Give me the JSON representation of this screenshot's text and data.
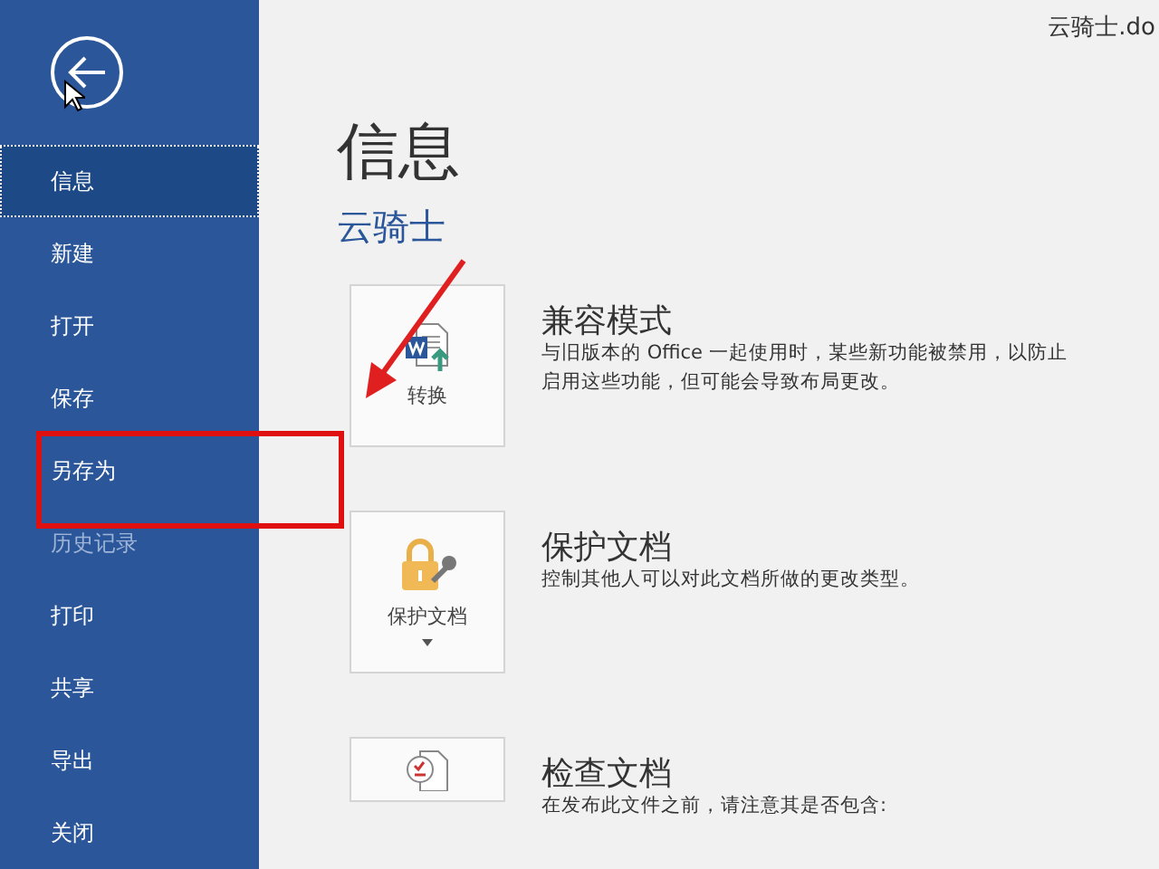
{
  "window": {
    "title": "云骑士.do"
  },
  "sidebar": {
    "items": [
      {
        "label": "信息",
        "selected": true,
        "disabled": false
      },
      {
        "label": "新建",
        "selected": false,
        "disabled": false
      },
      {
        "label": "打开",
        "selected": false,
        "disabled": false
      },
      {
        "label": "保存",
        "selected": false,
        "disabled": false
      },
      {
        "label": "另存为",
        "selected": false,
        "disabled": false
      },
      {
        "label": "历史记录",
        "selected": false,
        "disabled": true
      },
      {
        "label": "打印",
        "selected": false,
        "disabled": false
      },
      {
        "label": "共享",
        "selected": false,
        "disabled": false
      },
      {
        "label": "导出",
        "selected": false,
        "disabled": false
      },
      {
        "label": "关闭",
        "selected": false,
        "disabled": false
      }
    ]
  },
  "page": {
    "title": "信息",
    "document_name": "云骑士"
  },
  "sections": [
    {
      "kind": "convert",
      "button": "转换",
      "dropdown": false,
      "title": "兼容模式",
      "description": [
        "与旧版本的 Office 一起使用时，某些新功能被禁用，以防止",
        "启用这些功能，但可能会导致布局更改。"
      ]
    },
    {
      "kind": "protect",
      "button": "保护文档",
      "dropdown": true,
      "title": "保护文档",
      "description": [
        "控制其他人可以对此文档所做的更改类型。"
      ]
    },
    {
      "kind": "inspect",
      "title": "检查文档",
      "description": [
        "在发布此文件之前，请注意其是否包含:"
      ]
    }
  ]
}
